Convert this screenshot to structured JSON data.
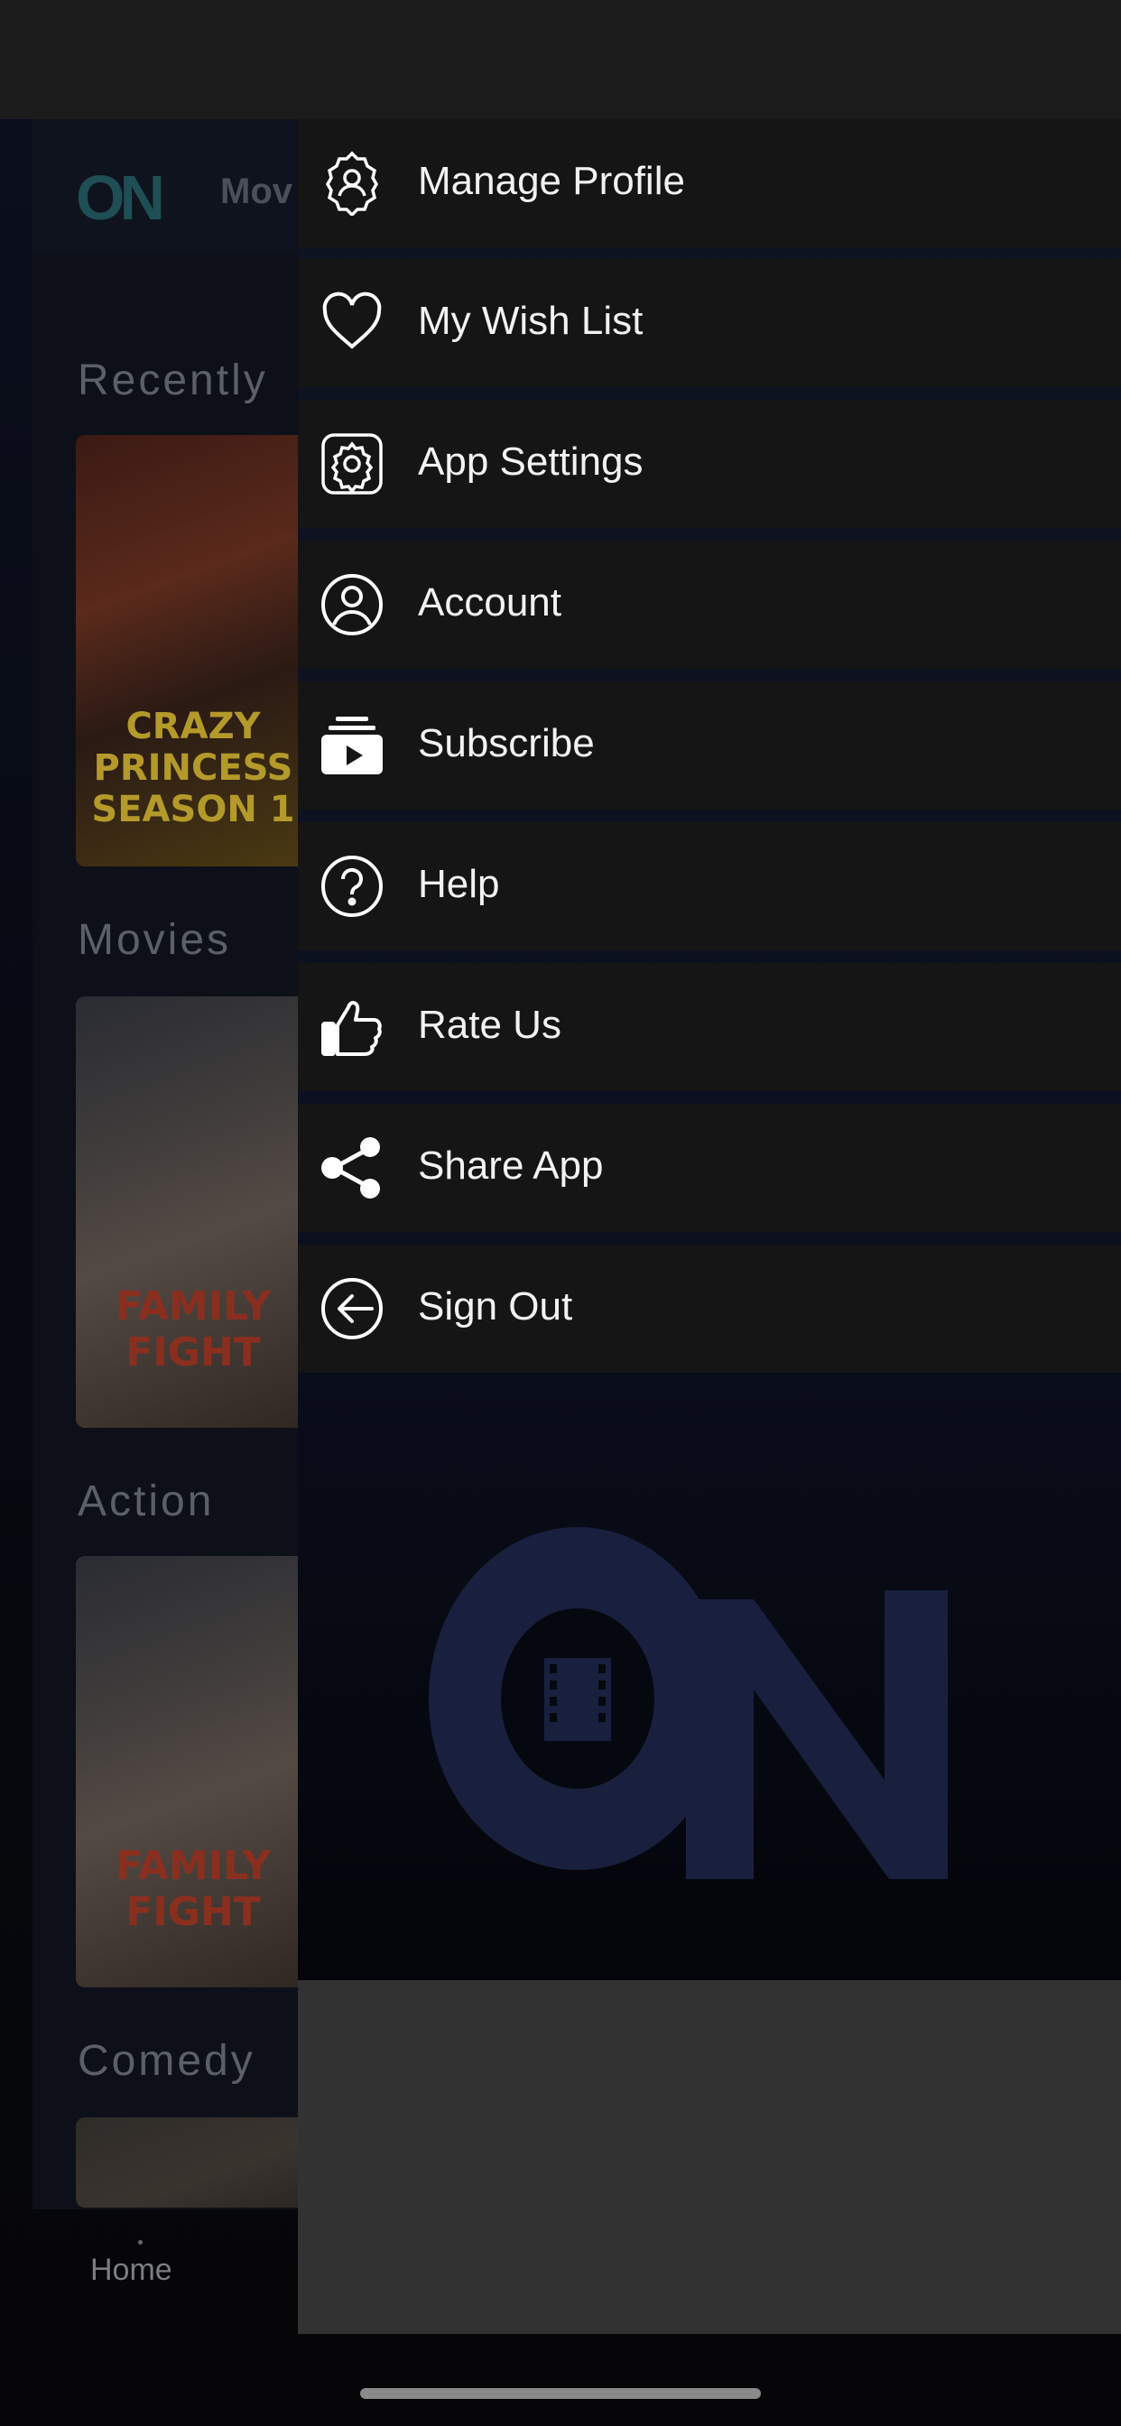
{
  "background_app": {
    "topbar_title": "Mov",
    "sections": [
      {
        "title": "Recently",
        "poster_text": "CRAZY PRINCESS SEASON 1"
      },
      {
        "title": "Movies",
        "poster_text": "FAMILY FIGHT"
      },
      {
        "title": "Action",
        "poster_text": "FAMILY FIGHT"
      },
      {
        "title": "Comedy",
        "poster_text": ""
      }
    ],
    "bottom_nav": {
      "home_label": "Home"
    }
  },
  "drawer": {
    "items": [
      {
        "label": "Manage Profile",
        "icon": "manage-profile-icon"
      },
      {
        "label": "My Wish List",
        "icon": "heart-icon"
      },
      {
        "label": "App Settings",
        "icon": "gear-icon"
      },
      {
        "label": "Account",
        "icon": "account-icon"
      },
      {
        "label": "Subscribe",
        "icon": "subscribe-icon"
      },
      {
        "label": "Help",
        "icon": "help-icon"
      },
      {
        "label": "Rate Us",
        "icon": "thumbs-up-icon"
      },
      {
        "label": "Share App",
        "icon": "share-icon"
      },
      {
        "label": "Sign Out",
        "icon": "sign-out-icon"
      }
    ],
    "logo_text": "ON"
  },
  "colors": {
    "drawer_item_bg": "#151515",
    "drawer_gradient": "#0f1422",
    "logo_color": "#18203d"
  }
}
